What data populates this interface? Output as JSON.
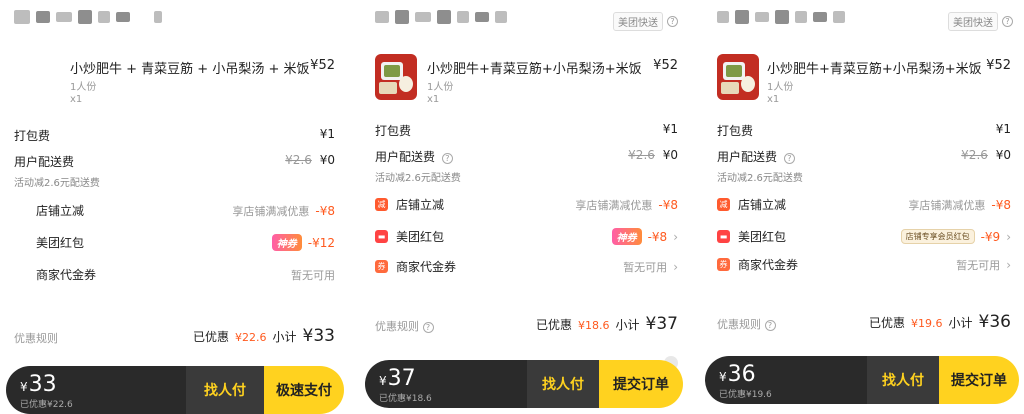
{
  "panels": [
    {
      "delivery_tag": "",
      "item": {
        "name": "小炒肥牛 + 青菜豆筋 + 小吊梨汤 + 米饭",
        "portion": "1人份",
        "qty": "x1",
        "price": "¥52"
      },
      "packing": {
        "label": "打包费",
        "value": "¥1"
      },
      "delivery": {
        "label": "用户配送费",
        "original": "¥2.6",
        "value": "¥0",
        "note": "活动减2.6元配送费"
      },
      "store_discount": {
        "label": "店铺立减",
        "desc": "享店铺满减优惠",
        "value": "-¥8"
      },
      "red_packet": {
        "label": "美团红包",
        "badge": "神券",
        "value": "-¥12"
      },
      "voucher": {
        "label": "商家代金券",
        "value": "暂无可用"
      },
      "summary": {
        "rules": "优惠规则",
        "saved_label": "已优惠",
        "saved": "¥22.6",
        "subtotal_label": "小计",
        "subtotal": "¥33"
      },
      "bar": {
        "currency": "¥",
        "amount": "33",
        "saved": "已优惠¥22.6",
        "find": "找人付",
        "pay": "极速支付"
      }
    },
    {
      "delivery_tag": "美团快送",
      "item": {
        "name": "小炒肥牛+青菜豆筋+小吊梨汤+米饭",
        "portion": "1人份",
        "qty": "x1",
        "price": "¥52"
      },
      "packing": {
        "label": "打包费",
        "value": "¥1"
      },
      "delivery": {
        "label": "用户配送费",
        "original": "¥2.6",
        "value": "¥0",
        "note": "活动减2.6元配送费"
      },
      "store_discount": {
        "label": "店铺立减",
        "desc": "享店铺满减优惠",
        "value": "-¥8",
        "icon": "减"
      },
      "red_packet": {
        "label": "美团红包",
        "badge": "神券",
        "value": "-¥8"
      },
      "voucher": {
        "label": "商家代金券",
        "value": "暂无可用",
        "icon": "券"
      },
      "summary": {
        "rules": "优惠规则",
        "saved_label": "已优惠",
        "saved": "¥18.6",
        "subtotal_label": "小计",
        "subtotal": "¥37"
      },
      "bar": {
        "currency": "¥",
        "amount": "37",
        "saved": "已优惠¥18.6",
        "find": "找人付",
        "pay": "提交订单"
      }
    },
    {
      "delivery_tag": "美团快送",
      "item": {
        "name": "小炒肥牛+青菜豆筋+小吊梨汤+米饭",
        "portion": "1人份",
        "qty": "x1",
        "price": "¥52"
      },
      "packing": {
        "label": "打包费",
        "value": "¥1"
      },
      "delivery": {
        "label": "用户配送费",
        "original": "¥2.6",
        "value": "¥0",
        "note": "活动减2.6元配送费"
      },
      "store_discount": {
        "label": "店铺立减",
        "desc": "享店铺满减优惠",
        "value": "-¥8",
        "icon": "减"
      },
      "red_packet": {
        "label": "美团红包",
        "badge": "店铺专享会员红包",
        "value": "-¥9"
      },
      "voucher": {
        "label": "商家代金券",
        "value": "暂无可用",
        "icon": "券"
      },
      "summary": {
        "rules": "优惠规则",
        "saved_label": "已优惠",
        "saved": "¥19.6",
        "subtotal_label": "小计",
        "subtotal": "¥36"
      },
      "bar": {
        "currency": "¥",
        "amount": "36",
        "saved": "已优惠¥19.6",
        "find": "找人付",
        "pay": "提交订单"
      }
    }
  ],
  "colors": {
    "accent_yellow": "#ffd21f",
    "discount_red": "#ff5a1f",
    "bar_dark": "#2a2a2a"
  }
}
